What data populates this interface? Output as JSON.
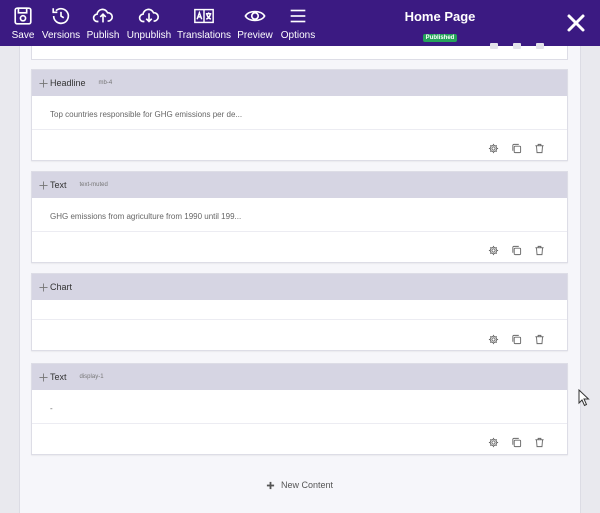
{
  "toolbar": {
    "save": "Save",
    "versions": "Versions",
    "publish": "Publish",
    "unpublish": "Unpublish",
    "translations": "Translations",
    "preview": "Preview",
    "options": "Options"
  },
  "page": {
    "title": "Home Page",
    "status": "Published"
  },
  "blocks": [
    {
      "type": "Headline",
      "css_class": "mb-4",
      "content": "Top countries responsible for GHG emissions per de..."
    },
    {
      "type": "Text",
      "css_class": "text-muted",
      "content": "GHG emissions from agriculture from 1990 until 199..."
    },
    {
      "type": "Chart",
      "css_class": "",
      "content": ""
    },
    {
      "type": "Text",
      "css_class": "display-1",
      "content": "-"
    }
  ],
  "new_content": "New Content",
  "icons": {
    "save": "floppy-disk-icon",
    "versions": "history-icon",
    "publish": "cloud-upload-icon",
    "unpublish": "cloud-download-icon",
    "translations": "translate-icon",
    "preview": "eye-icon",
    "options": "hamburger-menu-icon",
    "close": "close-icon",
    "move": "move-icon",
    "settings": "gear-icon",
    "duplicate": "copy-icon",
    "delete": "trash-icon",
    "add": "plus-icon"
  },
  "colors": {
    "toolbar_bg": "#3b1a82",
    "badge_bg": "#25a35a",
    "block_header_bg": "#d6d5e3"
  }
}
